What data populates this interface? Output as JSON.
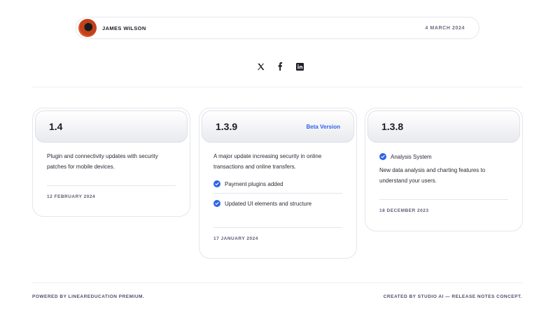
{
  "author": {
    "name": "JAMES WILSON",
    "date": "4 MARCH 2024"
  },
  "socials": [
    {
      "icon": "x-icon"
    },
    {
      "icon": "facebook-icon"
    },
    {
      "icon": "linkedin-icon"
    }
  ],
  "cards": [
    {
      "version": "1.4",
      "description": "Plugin and connectivity updates with security patches for mobile devices.",
      "date": "12 FEBRUARY 2024"
    },
    {
      "version": "1.3.9",
      "badge": "Beta Version",
      "description": "A major update increasing security in online transactions and online transfers.",
      "items": [
        "Payment plugins added",
        "Updated UI elements and structure"
      ],
      "date": "17 JANUARY 2024"
    },
    {
      "version": "1.3.8",
      "item": "Analysis System",
      "description": "New data analysis and charting features to understand your users.",
      "date": "18 DECEMBER 2023"
    }
  ],
  "footer": {
    "left": "POWERED BY LINEAREDUCATION PREMIUM.",
    "right": "CREATED BY STUDIO AI — RELEASE NOTES CONCEPT."
  },
  "colors": {
    "accent": "#2f63e8",
    "text": "#1c1d26",
    "muted": "#5b5d75",
    "border": "#e4e6ec"
  }
}
